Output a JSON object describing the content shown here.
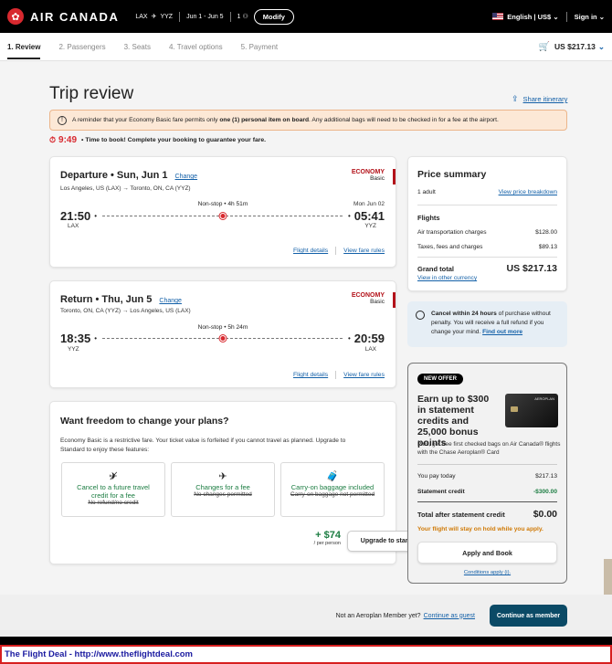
{
  "header": {
    "brand": "AIR CANADA",
    "from": "LAX",
    "to": "YYZ",
    "dates": "Jun 1 - Jun 5",
    "passengers": "1",
    "modify": "Modify",
    "language": "English",
    "currency": "US$",
    "signin": "Sign in"
  },
  "steps": [
    {
      "label": "1. Review"
    },
    {
      "label": "2. Passengers"
    },
    {
      "label": "3. Seats"
    },
    {
      "label": "4. Travel options"
    },
    {
      "label": "5. Payment"
    }
  ],
  "cart_total": "US $217.13",
  "page_title": "Trip review",
  "share": "Share itinerary",
  "alert": {
    "pre": "A reminder that your Economy Basic fare permits only ",
    "bold": "one (1) personal item on board",
    "post": ". Any additional bags will need to be checked in for a fee at the airport."
  },
  "timer": {
    "time": "9:49",
    "text": "• Time to book! Complete your booking to guarantee your fare."
  },
  "departure": {
    "title": "Departure • Sun, Jun 1",
    "change": "Change",
    "route": "Los Angeles, US (LAX) → Toronto, ON, CA (YYZ)",
    "cabin": "ECONOMY",
    "fare": "Basic",
    "dep_time": "21:50",
    "dep_code": "LAX",
    "arr_time": "05:41",
    "arr_code": "YYZ",
    "arr_date": "Mon Jun 02",
    "duration": "Non-stop • 4h 51m",
    "details": "Flight details",
    "rules": "View fare rules"
  },
  "return": {
    "title": "Return • Thu, Jun 5",
    "change": "Change",
    "route": "Toronto, ON, CA (YYZ) → Los Angeles, US (LAX)",
    "cabin": "ECONOMY",
    "fare": "Basic",
    "dep_time": "18:35",
    "dep_code": "YYZ",
    "arr_time": "20:59",
    "arr_code": "LAX",
    "duration": "Non-stop • 5h 24m",
    "details": "Flight details",
    "rules": "View fare rules"
  },
  "freedom": {
    "heading": "Want freedom to change your plans?",
    "desc": "Economy Basic is a restrictive fare. Your ticket value is forfeited if you cannot travel as planned. Upgrade to Standard to enjoy these features:",
    "features": [
      {
        "label": "Cancel to a future travel credit for a fee",
        "strike": "No refund/no credit",
        "icon": "plane-cancel-icon"
      },
      {
        "label": "Changes for a fee",
        "strike": "No changes permitted",
        "icon": "plane-icon"
      },
      {
        "label": "Carry-on baggage included",
        "strike": "Carry-on baggage not permitted",
        "icon": "baggage-icon"
      }
    ],
    "price": "+ $74",
    "per": "/ per person",
    "upgrade": "Upgrade to standard"
  },
  "summary": {
    "title": "Price summary",
    "adults": "1 adult",
    "breakdown": "View price breakdown",
    "flights": "Flights",
    "air_label": "Air transportation charges",
    "air_value": "$128.00",
    "tax_label": "Taxes, fees and charges",
    "tax_value": "$89.13",
    "grand_label": "Grand total",
    "grand_value": "US $217.13",
    "other_currency": "View in other currency"
  },
  "cancel": {
    "bold": "Cancel within 24 hours",
    "text": " of purchase without penalty. You will receive a full refund if you change your mind. ",
    "link": "Find out more"
  },
  "offer": {
    "badge": "NEW OFFER",
    "heading": "Earn up to $300 in statement credits and 25,000 bonus points",
    "card_label": "AEROPLAN",
    "desc": "Plus, get free first checked bags on Air Canada® flights with the Chase Aeroplan® Card",
    "pay_label": "You pay today",
    "pay_value": "$217.13",
    "credit_label": "Statement credit",
    "credit_value": "-$300.00",
    "total_label": "Total after statement credit",
    "total_value": "$0.00",
    "hold": "Your flight will stay on hold while you apply.",
    "apply": "Apply and Book",
    "conditions": "Conditions apply (i)."
  },
  "footer": {
    "guest_text": "Not an Aeroplan Member yet?",
    "guest_link": "Continue as guest",
    "member": "Continue as member"
  },
  "watermark": "The Flight Deal - http://www.theflightdeal.com",
  "colors": {
    "brand_red": "#d8292f",
    "navy_button": "#0b4a66",
    "green": "#1c7d42",
    "hold_orange": "#d07a06"
  }
}
